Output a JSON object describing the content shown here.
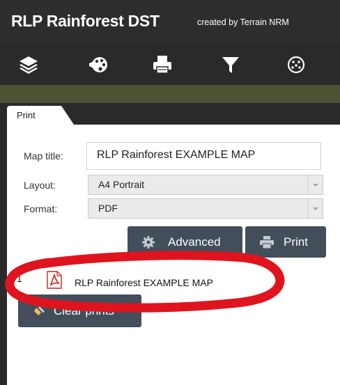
{
  "header": {
    "title": "RLP Rainforest DST",
    "credit": "created by Terrain NRM"
  },
  "toolbar": {
    "icons": [
      "layers-icon",
      "palette-icon",
      "printer-icon",
      "filter-icon",
      "chart-icon"
    ]
  },
  "panel": {
    "tab_label": "Print",
    "map_title_label": "Map title:",
    "map_title_value": "RLP Rainforest EXAMPLE MAP",
    "layout_label": "Layout:",
    "layout_value": "A4 Portrait",
    "format_label": "Format:",
    "format_value": "PDF",
    "advanced_label": "Advanced",
    "print_label": "Print",
    "results": [
      {
        "index": "1",
        "name": "RLP Rainforest EXAMPLE MAP"
      }
    ],
    "clear_label": "Clear prints"
  },
  "colors": {
    "button": "#434e5b",
    "accent_band": "#4c5434",
    "annotation": "#e0141e"
  }
}
